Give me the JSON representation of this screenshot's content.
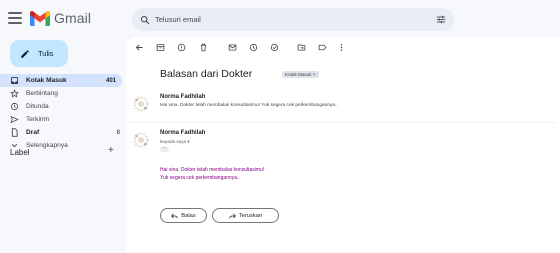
{
  "app": {
    "name": "Gmail"
  },
  "search": {
    "placeholder": "Telusuri email"
  },
  "compose": {
    "label": "Tulis"
  },
  "sidebar": {
    "items": [
      {
        "label": "Kotak Masuk",
        "count": "401",
        "icon": "inbox-icon"
      },
      {
        "label": "Berbintang",
        "count": "",
        "icon": "star-icon"
      },
      {
        "label": "Ditunda",
        "count": "",
        "icon": "clock-icon"
      },
      {
        "label": "Terkirim",
        "count": "",
        "icon": "send-icon"
      },
      {
        "label": "Draf",
        "count": "8",
        "icon": "draft-icon"
      },
      {
        "label": "Selengkapnya",
        "count": "",
        "icon": "chevron-down-icon"
      }
    ],
    "labels_header": "Label",
    "labels_add": "+"
  },
  "email": {
    "subject": "Balasan dari Dokter",
    "folder_chip": "Kotak Masuk ×",
    "messages": [
      {
        "sender": "Norma Fadhilah",
        "snippet": "Hai vina. Dokter telah membalas konsultasimu! Yuk segera cek perkembangannya.."
      },
      {
        "sender": "Norma Fadhilah",
        "to": "kepada saya ▾",
        "body": [
          "Hai vina. Dokter telah membalas konsultasimu!",
          "Yuk segera cek perkembangannya.."
        ]
      }
    ],
    "reply_label": "Balas",
    "forward_label": "Teruskan"
  },
  "colors": {
    "accent": "#c2e7ff",
    "active_nav": "#d3e3fd",
    "body_text": "#870087"
  }
}
